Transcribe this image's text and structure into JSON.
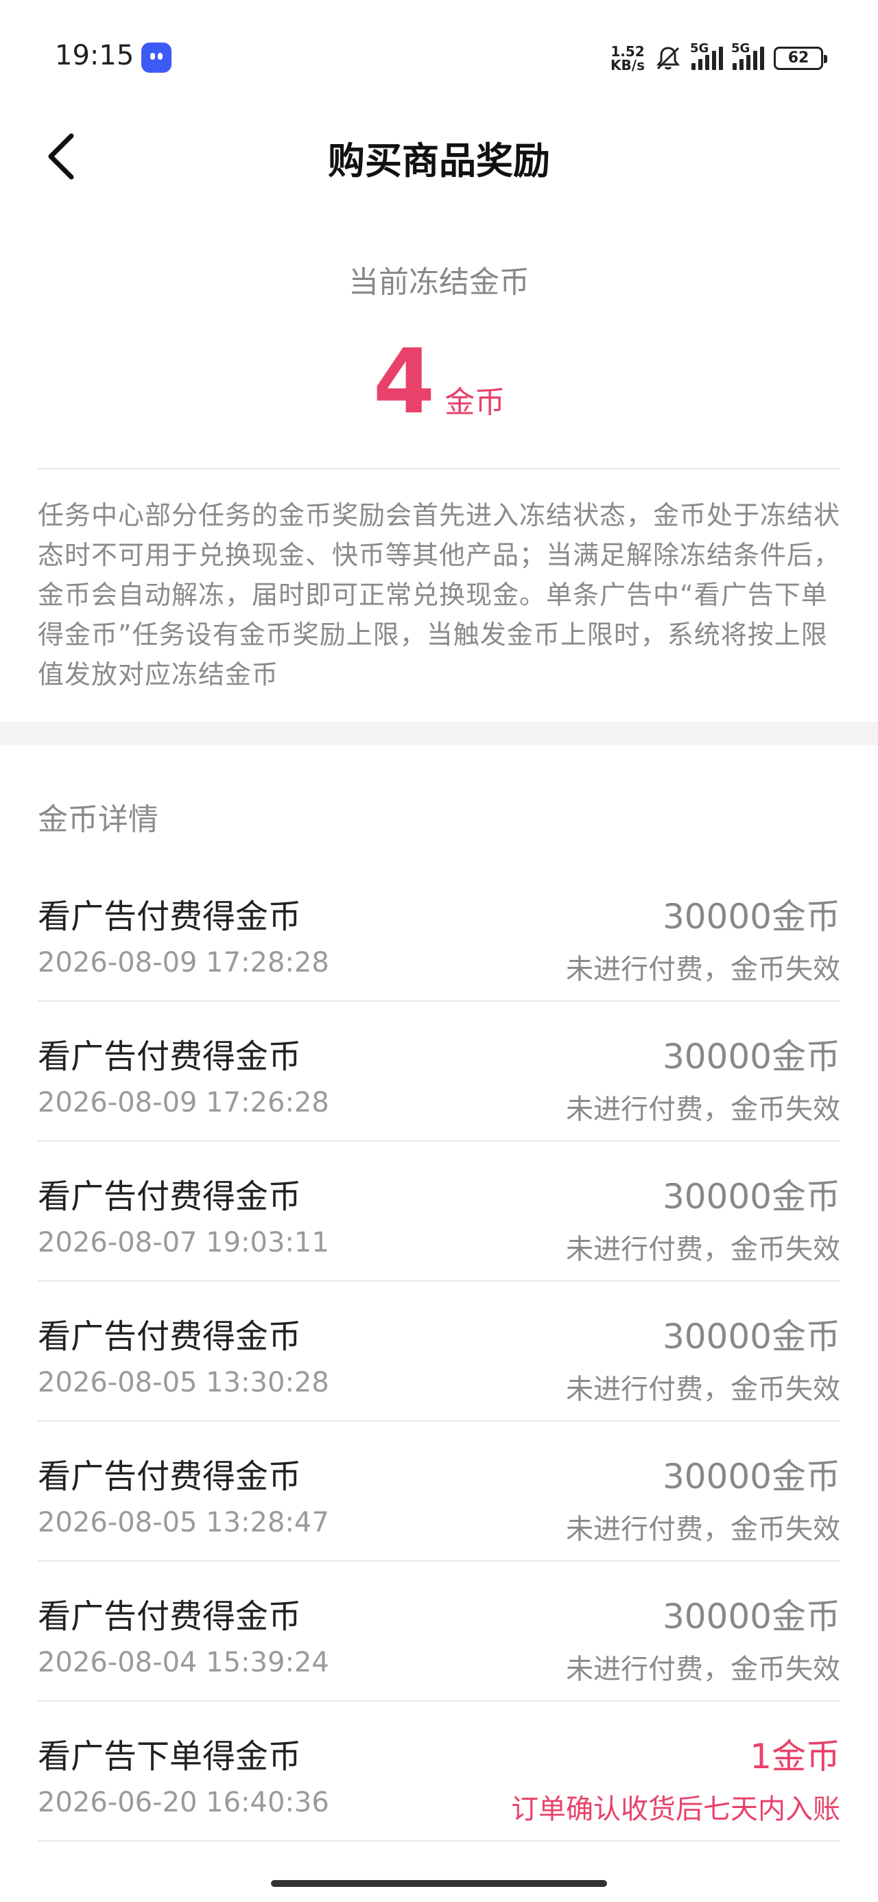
{
  "status_bar": {
    "time": "19:15",
    "net_speed_top": "1.52",
    "net_speed_bottom": "KB/s",
    "sim1": "5G",
    "sim2": "5G",
    "battery": "62"
  },
  "header": {
    "title": "购买商品奖励"
  },
  "frozen": {
    "label": "当前冻结金币",
    "amount": "4",
    "unit": "金币",
    "accent_color": "#e8426a"
  },
  "description": "任务中心部分任务的金币奖励会首先进入冻结状态，金币处于冻结状态时不可用于兑换现金、快币等其他产品；当满足解除冻结条件后，金币会自动解冻，届时即可正常兑换现金。单条广告中“看广告下单得金币”任务设有金币奖励上限，当触发金币上限时，系统将按上限值发放对应冻结金币",
  "details": {
    "title": "金币详情",
    "rows": [
      {
        "name": "看广告付费得金币",
        "date": "2026-08-09 17:28:28",
        "amount": "30000金币",
        "status": "未进行付费，金币失效"
      },
      {
        "name": "看广告付费得金币",
        "date": "2026-08-09 17:26:28",
        "amount": "30000金币",
        "status": "未进行付费，金币失效"
      },
      {
        "name": "看广告付费得金币",
        "date": "2026-08-07 19:03:11",
        "amount": "30000金币",
        "status": "未进行付费，金币失效"
      },
      {
        "name": "看广告付费得金币",
        "date": "2026-08-05 13:30:28",
        "amount": "30000金币",
        "status": "未进行付费，金币失效"
      },
      {
        "name": "看广告付费得金币",
        "date": "2026-08-05 13:28:47",
        "amount": "30000金币",
        "status": "未进行付费，金币失效"
      },
      {
        "name": "看广告付费得金币",
        "date": "2026-08-04 15:39:24",
        "amount": "30000金币",
        "status": "未进行付费，金币失效"
      },
      {
        "name": "看广告下单得金币",
        "date": "2026-06-20 16:40:36",
        "amount": "1金币",
        "status": "订单确认收货后七天内入账"
      }
    ]
  }
}
